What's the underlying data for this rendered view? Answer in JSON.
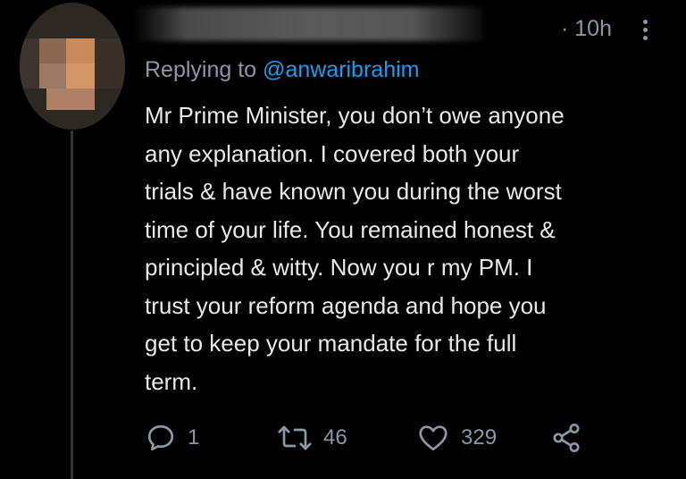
{
  "tweet": {
    "time": "· 10h",
    "replying_prefix": "Replying to ",
    "replying_handle": "@anwaribrahim",
    "lines": [
      "Mr Prime Minister, you don’t owe anyone",
      "any explanation. I covered both your",
      "trials & have known you during the worst",
      "time of your life. You remained honest &",
      "principled & witty. Now you r my PM. I",
      "trust your reform agenda and hope you",
      "get to keep your mandate for the full",
      "term."
    ]
  },
  "actions": {
    "reply_count": "1",
    "retweet_count": "46",
    "like_count": "329"
  },
  "icons": {
    "more": "more-vertical-icon",
    "reply": "reply-icon",
    "retweet": "retweet-icon",
    "like": "heart-icon",
    "share": "share-icon"
  },
  "colors": {
    "background": "#000000",
    "text": "#e7e9ea",
    "secondary": "#8b98a5",
    "link": "#1d9bf0"
  }
}
